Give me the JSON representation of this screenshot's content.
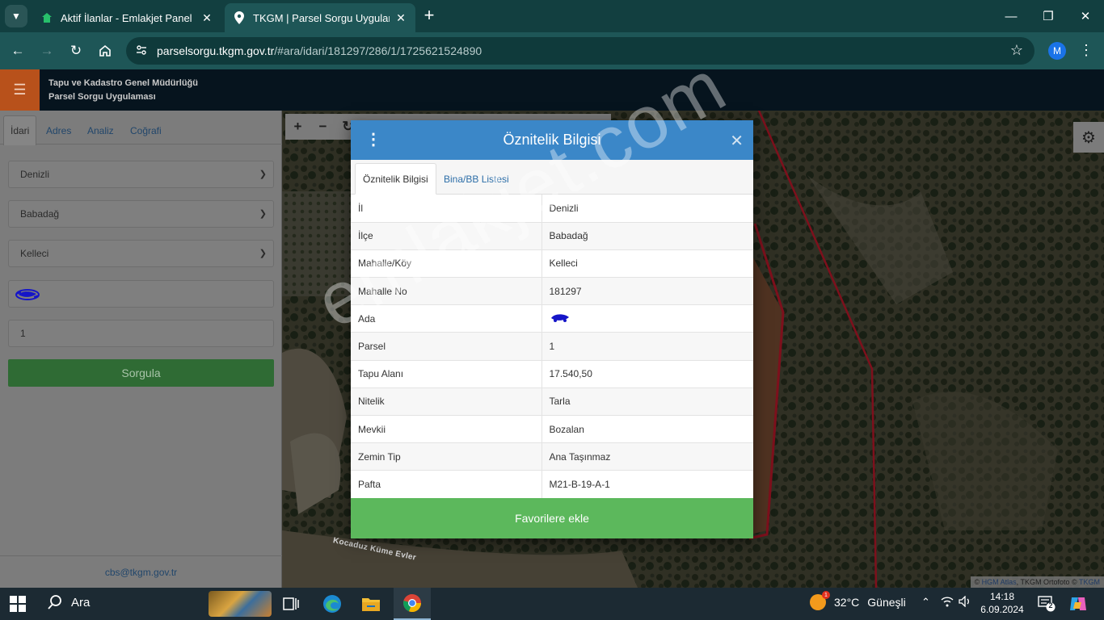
{
  "browser": {
    "tabs": [
      {
        "title": "Aktif İlanlar - Emlakjet Panel",
        "active": false
      },
      {
        "title": "TKGM | Parsel Sorgu Uygulaması",
        "active": true
      }
    ],
    "url_host": "parselsorgu.tkgm.gov.tr",
    "url_path": "/#ara/idari/181297/286/1/1725621524890",
    "profile_initial": "M"
  },
  "app": {
    "header_line1": "Tapu ve Kadastro Genel Müdürlüğü",
    "header_line2": "Parsel Sorgu Uygulaması"
  },
  "sidebar": {
    "tabs": [
      "İdari",
      "Adres",
      "Analiz",
      "Coğrafi"
    ],
    "il": "Denizli",
    "ilce": "Babadağ",
    "mahalle": "Kelleci",
    "parsel": "1",
    "submit_label": "Sorgula",
    "footer_email": "cbs@tkgm.gov.tr"
  },
  "map": {
    "place_label": "Kocaduz Küme Evler",
    "attribution_prefix": "© ",
    "attribution_link1": "HGM Atlas",
    "attribution_mid": ", TKGM Ortofoto © ",
    "attribution_link2": "TKGM",
    "parcel_outline_color": "#c0192b",
    "boundary_line_color": "#c0192b"
  },
  "modal": {
    "title": "Öznitelik Bilgisi",
    "tabs": [
      "Öznitelik Bilgisi",
      "Bina/BB Listesi"
    ],
    "rows": [
      {
        "key": "İl",
        "value": "Denizli"
      },
      {
        "key": "İlçe",
        "value": "Babadağ"
      },
      {
        "key": "Mahalle/Köy",
        "value": "Kelleci"
      },
      {
        "key": "Mahalle No",
        "value": "181297"
      },
      {
        "key": "Ada",
        "value": ""
      },
      {
        "key": "Parsel",
        "value": "1"
      },
      {
        "key": "Tapu Alanı",
        "value": "17.540,50"
      },
      {
        "key": "Nitelik",
        "value": "Tarla"
      },
      {
        "key": "Mevkii",
        "value": "Bozalan"
      },
      {
        "key": "Zemin Tip",
        "value": "Ana Taşınmaz"
      },
      {
        "key": "Pafta",
        "value": "M21-B-19-A-1"
      }
    ],
    "favorite_label": "Favorilere ekle",
    "header_color": "#3b87c8",
    "button_color": "#5cb85c"
  },
  "watermark": "emlakjet.com",
  "taskbar": {
    "search_label": "Ara",
    "temperature": "32°C",
    "weather_condition": "Güneşli",
    "weather_alert_count": "1",
    "time": "14:18",
    "date": "6.09.2024",
    "notification_count": "2"
  }
}
